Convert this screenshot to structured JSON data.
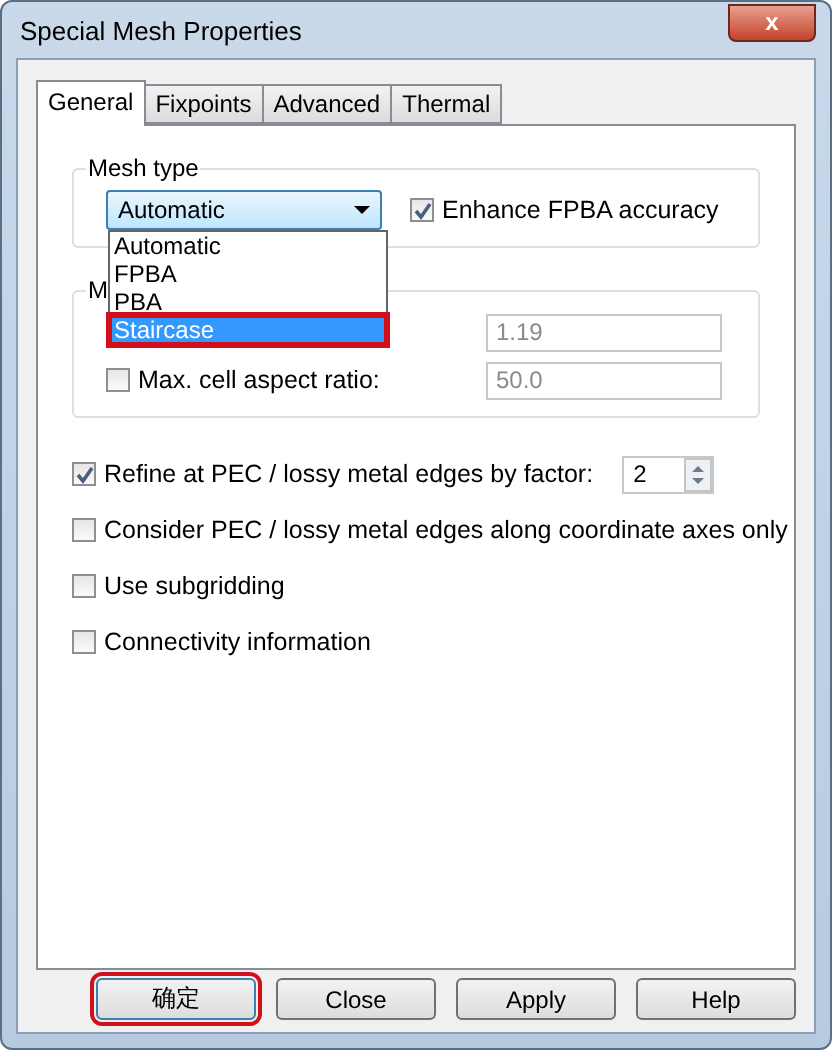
{
  "window": {
    "title": "Special Mesh Properties",
    "close": "x"
  },
  "tabs": [
    {
      "label": "General",
      "selected": true
    },
    {
      "label": "Fixpoints",
      "selected": false
    },
    {
      "label": "Advanced",
      "selected": false
    },
    {
      "label": "Thermal",
      "selected": false
    }
  ],
  "mesh_type": {
    "legend": "Mesh type",
    "combo_value": "Automatic",
    "options": [
      {
        "label": "Automatic",
        "selected": false
      },
      {
        "label": "FPBA",
        "selected": false
      },
      {
        "label": "PBA",
        "selected": false
      },
      {
        "label": "Staircase",
        "selected": true
      }
    ],
    "enhance": {
      "label": "Enhance FPBA accuracy",
      "checked": true
    }
  },
  "group_2": {
    "legend": "M",
    "first_value": "1.19",
    "aspect": {
      "label": "Max. cell aspect ratio:",
      "checked": false,
      "value": "50.0"
    }
  },
  "options": [
    {
      "kind": "spinner",
      "label": "Refine at PEC / lossy metal edges by factor:",
      "checked": true,
      "value": "2"
    },
    {
      "kind": "check",
      "label": "Consider PEC / lossy metal edges along coordinate axes only",
      "checked": false
    },
    {
      "kind": "check",
      "label": "Use subgridding",
      "checked": false
    },
    {
      "kind": "check",
      "label": "Connectivity information",
      "checked": false
    }
  ],
  "buttons": [
    {
      "label": "确定",
      "selected": true
    },
    {
      "label": "Close",
      "selected": false
    },
    {
      "label": "Apply",
      "selected": false
    },
    {
      "label": "Help",
      "selected": false
    }
  ]
}
